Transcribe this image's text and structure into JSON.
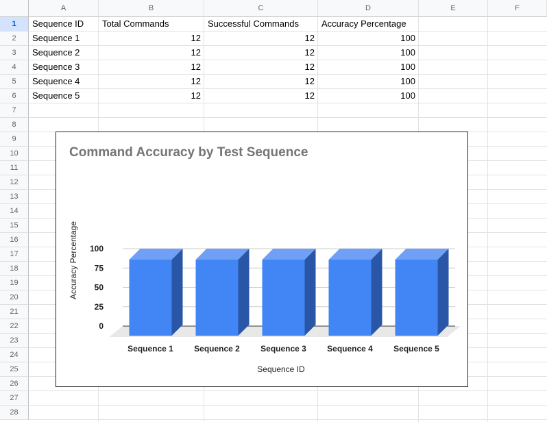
{
  "sheet": {
    "columns": [
      "A",
      "B",
      "C",
      "D",
      "E",
      "F"
    ],
    "rows": [
      "1",
      "2",
      "3",
      "4",
      "5",
      "6",
      "7",
      "8",
      "9",
      "10",
      "11",
      "12",
      "13",
      "14",
      "15",
      "16",
      "17",
      "18",
      "19",
      "20",
      "21",
      "22",
      "23",
      "24",
      "25",
      "26",
      "27",
      "28"
    ],
    "selected_row": "1",
    "cells": [
      [
        "Sequence ID",
        "Total Commands",
        "Successful Commands",
        "Accuracy Percentage"
      ],
      [
        "Sequence 1",
        "12",
        "12",
        "100"
      ],
      [
        "Sequence 2",
        "12",
        "12",
        "100"
      ],
      [
        "Sequence 3",
        "12",
        "12",
        "100"
      ],
      [
        "Sequence 4",
        "12",
        "12",
        "100"
      ],
      [
        "Sequence 5",
        "12",
        "12",
        "100"
      ]
    ]
  },
  "chart_data": {
    "type": "bar",
    "title": "Command Accuracy by Test Sequence",
    "xlabel": "Sequence ID",
    "ylabel": "Accuracy Percentage",
    "categories": [
      "Sequence 1",
      "Sequence 2",
      "Sequence 3",
      "Sequence 4",
      "Sequence 5"
    ],
    "series": [
      {
        "values": [
          100,
          100,
          100,
          100,
          100
        ]
      }
    ],
    "yticks": [
      "0",
      "25",
      "50",
      "75",
      "100"
    ],
    "ylim": [
      0,
      100
    ],
    "grid": true,
    "legend": "none",
    "style": "3d",
    "colors": {
      "bar_front": "#4285f4",
      "bar_top": "#6fa0f6",
      "bar_side": "#2a56a7",
      "title": "#757575"
    }
  }
}
